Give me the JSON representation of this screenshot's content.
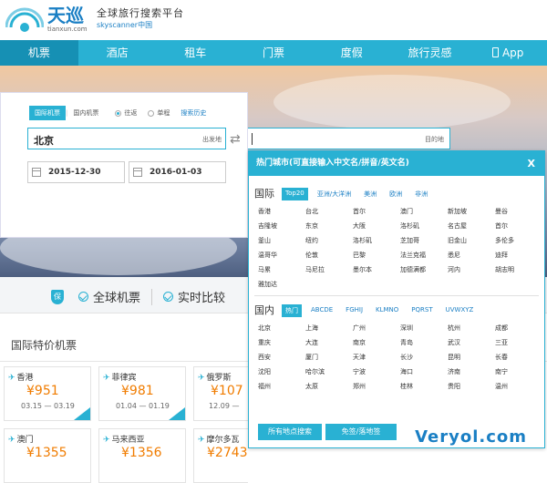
{
  "brand": {
    "name_cn": "天巡",
    "name_en": "tianxun.com",
    "slogan_cn": "全球旅行搜索平台",
    "slogan_en": "skyscanner中国"
  },
  "nav": {
    "items": [
      "机票",
      "酒店",
      "租车",
      "门票",
      "度假",
      "旅行灵感",
      "App"
    ]
  },
  "search": {
    "tab_international": "国际机票",
    "tab_domestic": "国内机票",
    "radio_oneway": "往返",
    "radio_roundtrip": "单程",
    "history": "搜索历史",
    "from_value": "北京",
    "from_label": "出发地",
    "to_label": "目的地",
    "depart_date": "2015-12-30",
    "return_date": "2016-01-03"
  },
  "features": {
    "item1": "全球机票",
    "item2": "实时比较"
  },
  "section": {
    "title": "国际特价机票"
  },
  "cards": [
    {
      "city": "香港",
      "price": "¥951",
      "dates": "03.15 — 03.19"
    },
    {
      "city": "菲律宾",
      "price": "¥981",
      "dates": "01.04 — 01.19"
    },
    {
      "city": "俄罗斯",
      "price": "¥107",
      "dates": "12.09 —"
    },
    {
      "city": "澳门",
      "price": "¥1355",
      "dates": ""
    },
    {
      "city": "马来西亚",
      "price": "¥1356",
      "dates": ""
    },
    {
      "city": "摩尔多瓦",
      "price": "¥2743",
      "dates": ""
    }
  ],
  "popup": {
    "title": "热门城市(可直接输入中文名/拼音/英文名)",
    "close": "X",
    "intl_label": "国际",
    "intl_tabs": [
      "Top20",
      "亚洲/大洋洲",
      "美洲",
      "欧洲",
      "非洲"
    ],
    "intl_cities": [
      "香港",
      "台北",
      "首尔",
      "澳门",
      "新加坡",
      "曼谷",
      "吉隆坡",
      "东京",
      "大阪",
      "洛杉矶",
      "名古屋",
      "首尔",
      "釜山",
      "纽约",
      "洛杉矶",
      "芝加哥",
      "旧金山",
      "多伦多",
      "温哥华",
      "伦敦",
      "巴黎",
      "法兰克福",
      "悉尼",
      "迪拜",
      "马累",
      "马尼拉",
      "墨尔本",
      "加德满都",
      "河内",
      "胡志明",
      "雅加达"
    ],
    "dom_label": "国内",
    "dom_tabs": [
      "热门",
      "ABCDE",
      "FGHIJ",
      "KLMNO",
      "PQRST",
      "UVWXYZ"
    ],
    "dom_cities": [
      "北京",
      "上海",
      "广州",
      "深圳",
      "杭州",
      "成都",
      "重庆",
      "大连",
      "南京",
      "青岛",
      "武汉",
      "三亚",
      "西安",
      "厦门",
      "天津",
      "长沙",
      "昆明",
      "长春",
      "沈阳",
      "哈尔滨",
      "宁波",
      "海口",
      "济南",
      "南宁",
      "福州",
      "太原",
      "郑州",
      "桂林",
      "贵阳",
      "温州"
    ],
    "btn_all": "所有地点搜索",
    "btn_nearby": "免签/落地签"
  },
  "watermark": "Veryol.com",
  "colors": {
    "accent": "#29b1d3",
    "price": "#f07c00"
  }
}
